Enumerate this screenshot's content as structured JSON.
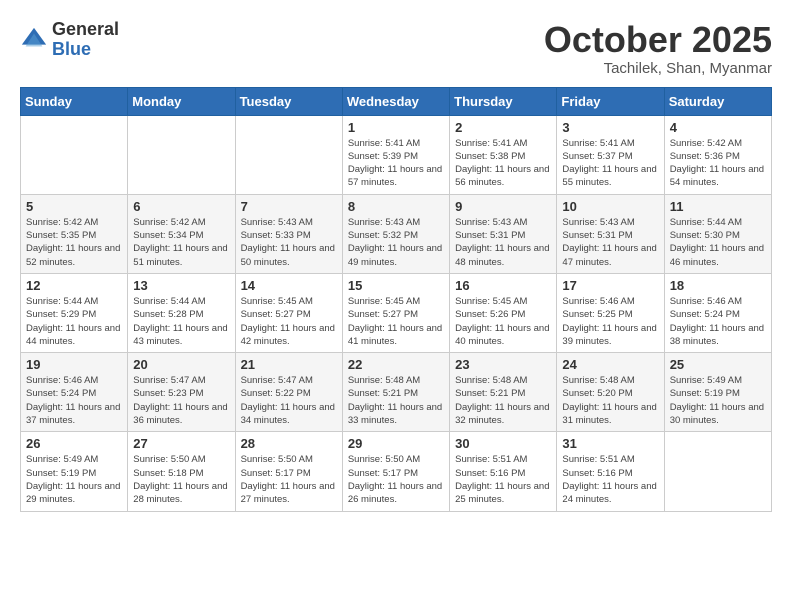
{
  "header": {
    "logo_general": "General",
    "logo_blue": "Blue",
    "month": "October 2025",
    "location": "Tachilek, Shan, Myanmar"
  },
  "weekdays": [
    "Sunday",
    "Monday",
    "Tuesday",
    "Wednesday",
    "Thursday",
    "Friday",
    "Saturday"
  ],
  "weeks": [
    [
      {
        "day": "",
        "info": ""
      },
      {
        "day": "",
        "info": ""
      },
      {
        "day": "",
        "info": ""
      },
      {
        "day": "1",
        "info": "Sunrise: 5:41 AM\nSunset: 5:39 PM\nDaylight: 11 hours and 57 minutes."
      },
      {
        "day": "2",
        "info": "Sunrise: 5:41 AM\nSunset: 5:38 PM\nDaylight: 11 hours and 56 minutes."
      },
      {
        "day": "3",
        "info": "Sunrise: 5:41 AM\nSunset: 5:37 PM\nDaylight: 11 hours and 55 minutes."
      },
      {
        "day": "4",
        "info": "Sunrise: 5:42 AM\nSunset: 5:36 PM\nDaylight: 11 hours and 54 minutes."
      }
    ],
    [
      {
        "day": "5",
        "info": "Sunrise: 5:42 AM\nSunset: 5:35 PM\nDaylight: 11 hours and 52 minutes."
      },
      {
        "day": "6",
        "info": "Sunrise: 5:42 AM\nSunset: 5:34 PM\nDaylight: 11 hours and 51 minutes."
      },
      {
        "day": "7",
        "info": "Sunrise: 5:43 AM\nSunset: 5:33 PM\nDaylight: 11 hours and 50 minutes."
      },
      {
        "day": "8",
        "info": "Sunrise: 5:43 AM\nSunset: 5:32 PM\nDaylight: 11 hours and 49 minutes."
      },
      {
        "day": "9",
        "info": "Sunrise: 5:43 AM\nSunset: 5:31 PM\nDaylight: 11 hours and 48 minutes."
      },
      {
        "day": "10",
        "info": "Sunrise: 5:43 AM\nSunset: 5:31 PM\nDaylight: 11 hours and 47 minutes."
      },
      {
        "day": "11",
        "info": "Sunrise: 5:44 AM\nSunset: 5:30 PM\nDaylight: 11 hours and 46 minutes."
      }
    ],
    [
      {
        "day": "12",
        "info": "Sunrise: 5:44 AM\nSunset: 5:29 PM\nDaylight: 11 hours and 44 minutes."
      },
      {
        "day": "13",
        "info": "Sunrise: 5:44 AM\nSunset: 5:28 PM\nDaylight: 11 hours and 43 minutes."
      },
      {
        "day": "14",
        "info": "Sunrise: 5:45 AM\nSunset: 5:27 PM\nDaylight: 11 hours and 42 minutes."
      },
      {
        "day": "15",
        "info": "Sunrise: 5:45 AM\nSunset: 5:27 PM\nDaylight: 11 hours and 41 minutes."
      },
      {
        "day": "16",
        "info": "Sunrise: 5:45 AM\nSunset: 5:26 PM\nDaylight: 11 hours and 40 minutes."
      },
      {
        "day": "17",
        "info": "Sunrise: 5:46 AM\nSunset: 5:25 PM\nDaylight: 11 hours and 39 minutes."
      },
      {
        "day": "18",
        "info": "Sunrise: 5:46 AM\nSunset: 5:24 PM\nDaylight: 11 hours and 38 minutes."
      }
    ],
    [
      {
        "day": "19",
        "info": "Sunrise: 5:46 AM\nSunset: 5:24 PM\nDaylight: 11 hours and 37 minutes."
      },
      {
        "day": "20",
        "info": "Sunrise: 5:47 AM\nSunset: 5:23 PM\nDaylight: 11 hours and 36 minutes."
      },
      {
        "day": "21",
        "info": "Sunrise: 5:47 AM\nSunset: 5:22 PM\nDaylight: 11 hours and 34 minutes."
      },
      {
        "day": "22",
        "info": "Sunrise: 5:48 AM\nSunset: 5:21 PM\nDaylight: 11 hours and 33 minutes."
      },
      {
        "day": "23",
        "info": "Sunrise: 5:48 AM\nSunset: 5:21 PM\nDaylight: 11 hours and 32 minutes."
      },
      {
        "day": "24",
        "info": "Sunrise: 5:48 AM\nSunset: 5:20 PM\nDaylight: 11 hours and 31 minutes."
      },
      {
        "day": "25",
        "info": "Sunrise: 5:49 AM\nSunset: 5:19 PM\nDaylight: 11 hours and 30 minutes."
      }
    ],
    [
      {
        "day": "26",
        "info": "Sunrise: 5:49 AM\nSunset: 5:19 PM\nDaylight: 11 hours and 29 minutes."
      },
      {
        "day": "27",
        "info": "Sunrise: 5:50 AM\nSunset: 5:18 PM\nDaylight: 11 hours and 28 minutes."
      },
      {
        "day": "28",
        "info": "Sunrise: 5:50 AM\nSunset: 5:17 PM\nDaylight: 11 hours and 27 minutes."
      },
      {
        "day": "29",
        "info": "Sunrise: 5:50 AM\nSunset: 5:17 PM\nDaylight: 11 hours and 26 minutes."
      },
      {
        "day": "30",
        "info": "Sunrise: 5:51 AM\nSunset: 5:16 PM\nDaylight: 11 hours and 25 minutes."
      },
      {
        "day": "31",
        "info": "Sunrise: 5:51 AM\nSunset: 5:16 PM\nDaylight: 11 hours and 24 minutes."
      },
      {
        "day": "",
        "info": ""
      }
    ]
  ]
}
